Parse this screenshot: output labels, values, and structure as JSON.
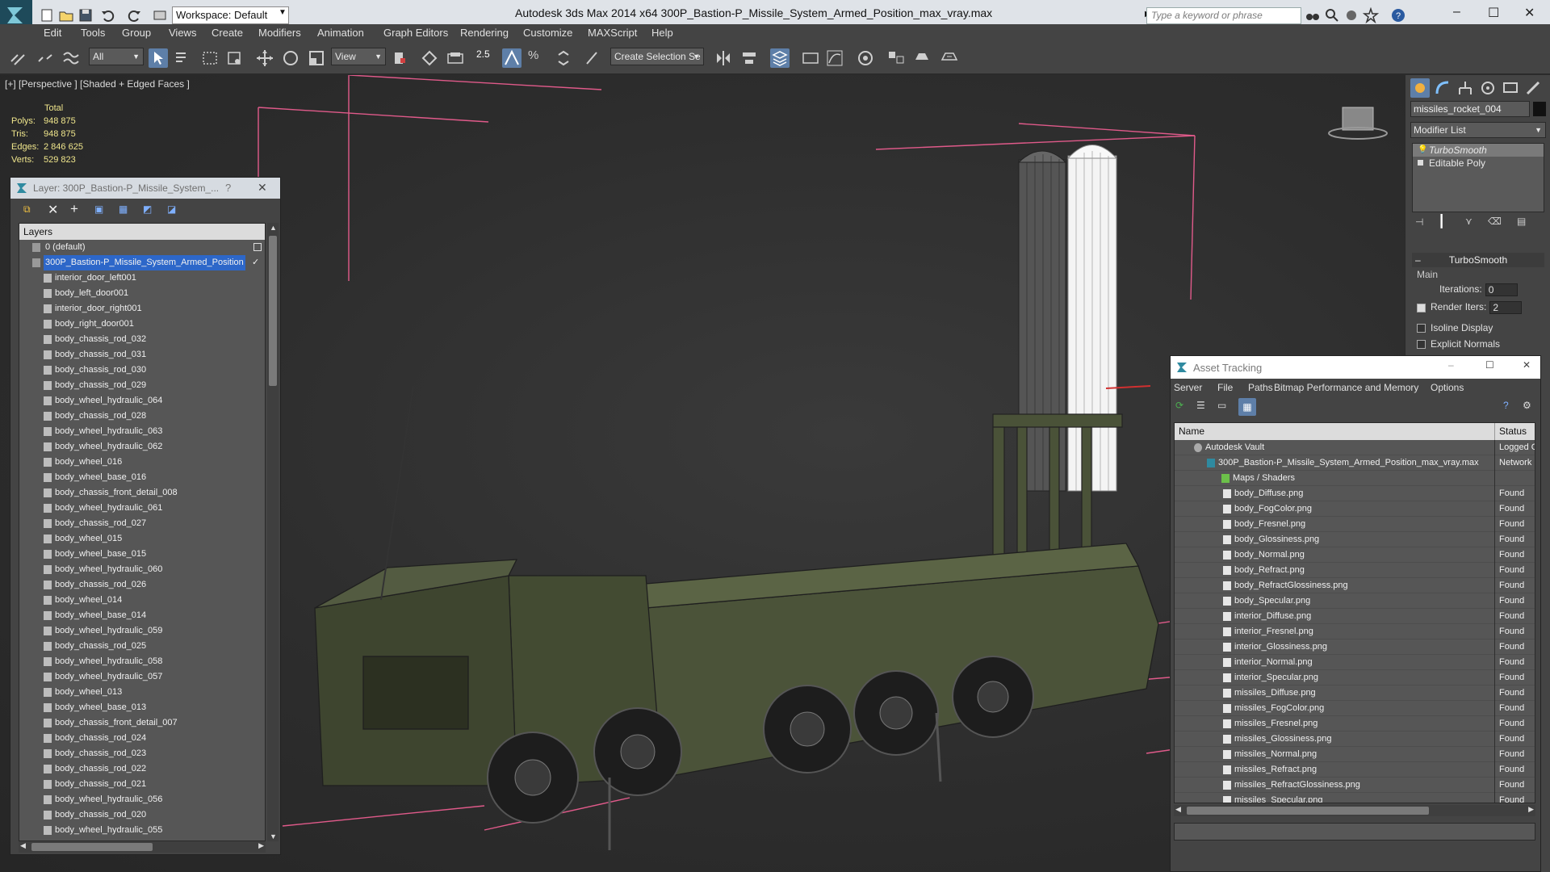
{
  "titlebar": {
    "workspace": "Workspace: Default",
    "title": "Autodesk 3ds Max  2014 x64      300P_Bastion-P_Missile_System_Armed_Position_max_vray.max",
    "search_placeholder": "Type a keyword or phrase",
    "minimize": "–",
    "maximize": "☐",
    "close": "✕"
  },
  "menu": [
    "Edit",
    "Tools",
    "Group",
    "Views",
    "Create",
    "Modifiers",
    "Animation",
    "Graph Editors",
    "Rendering",
    "Customize",
    "MAXScript",
    "Help"
  ],
  "toolbar": {
    "selection_filter": "All",
    "ref_coord": "View",
    "snap_label": "2.5",
    "named_selection": "Create Selection Se"
  },
  "viewport": {
    "label": "[+] [Perspective ] [Shaded + Edged Faces ]",
    "stats_header": "Total",
    "stats": [
      {
        "label": "Polys:",
        "value": "948 875"
      },
      {
        "label": "Tris:",
        "value": "948 875"
      },
      {
        "label": "Edges:",
        "value": "2 846 625"
      },
      {
        "label": "Verts:",
        "value": "529 823"
      }
    ]
  },
  "layer_panel": {
    "title": "Layer: 300P_Bastion-P_Missile_System_...",
    "help": "?",
    "close": "✕",
    "header": "Layers",
    "default_layer": "0 (default)",
    "selected_layer": "300P_Bastion-P_Missile_System_Armed_Position",
    "objects": [
      "interior_door_left001",
      "body_left_door001",
      "interior_door_right001",
      "body_right_door001",
      "body_chassis_rod_032",
      "body_chassis_rod_031",
      "body_chassis_rod_030",
      "body_chassis_rod_029",
      "body_wheel_hydraulic_064",
      "body_chassis_rod_028",
      "body_wheel_hydraulic_063",
      "body_wheel_hydraulic_062",
      "body_wheel_016",
      "body_wheel_base_016",
      "body_chassis_front_detail_008",
      "body_wheel_hydraulic_061",
      "body_chassis_rod_027",
      "body_wheel_015",
      "body_wheel_base_015",
      "body_wheel_hydraulic_060",
      "body_chassis_rod_026",
      "body_wheel_014",
      "body_wheel_base_014",
      "body_wheel_hydraulic_059",
      "body_chassis_rod_025",
      "body_wheel_hydraulic_058",
      "body_wheel_hydraulic_057",
      "body_wheel_013",
      "body_wheel_base_013",
      "body_chassis_front_detail_007",
      "body_chassis_rod_024",
      "body_chassis_rod_023",
      "body_chassis_rod_022",
      "body_chassis_rod_021",
      "body_wheel_hydraulic_056",
      "body_chassis_rod_020",
      "body_wheel_hydraulic_055"
    ]
  },
  "cmdpanel": {
    "object_name": "missiles_rocket_004",
    "modifier_list": "Modifier List",
    "stack": [
      "TurboSmooth",
      "Editable Poly"
    ],
    "rollout_title": "TurboSmooth",
    "group_main": "Main",
    "iterations_label": "Iterations:",
    "iterations_value": "0",
    "render_iters_label": "Render Iters:",
    "render_iters_value": "2",
    "isoline": "Isoline Display",
    "explicit_normals": "Explicit Normals"
  },
  "asset_panel": {
    "title": "Asset Tracking",
    "menu": [
      "Server",
      "File",
      "Paths",
      "Bitmap Performance and Memory",
      "Options"
    ],
    "col_name": "Name",
    "col_status": "Status",
    "vault": {
      "name": "Autodesk Vault",
      "status": "Logged Ou"
    },
    "file": {
      "name": "300P_Bastion-P_Missile_System_Armed_Position_max_vray.max",
      "status": "Network P"
    },
    "group": "Maps / Shaders",
    "maps": [
      {
        "name": "body_Diffuse.png",
        "status": "Found"
      },
      {
        "name": "body_FogColor.png",
        "status": "Found"
      },
      {
        "name": "body_Fresnel.png",
        "status": "Found"
      },
      {
        "name": "body_Glossiness.png",
        "status": "Found"
      },
      {
        "name": "body_Normal.png",
        "status": "Found"
      },
      {
        "name": "body_Refract.png",
        "status": "Found"
      },
      {
        "name": "body_RefractGlossiness.png",
        "status": "Found"
      },
      {
        "name": "body_Specular.png",
        "status": "Found"
      },
      {
        "name": "interior_Diffuse.png",
        "status": "Found"
      },
      {
        "name": "interior_Fresnel.png",
        "status": "Found"
      },
      {
        "name": "interior_Glossiness.png",
        "status": "Found"
      },
      {
        "name": "interior_Normal.png",
        "status": "Found"
      },
      {
        "name": "interior_Specular.png",
        "status": "Found"
      },
      {
        "name": "missiles_Diffuse.png",
        "status": "Found"
      },
      {
        "name": "missiles_FogColor.png",
        "status": "Found"
      },
      {
        "name": "missiles_Fresnel.png",
        "status": "Found"
      },
      {
        "name": "missiles_Glossiness.png",
        "status": "Found"
      },
      {
        "name": "missiles_Normal.png",
        "status": "Found"
      },
      {
        "name": "missiles_Refract.png",
        "status": "Found"
      },
      {
        "name": "missiles_RefractGlossiness.png",
        "status": "Found"
      },
      {
        "name": "missiles_Specular.png",
        "status": "Found"
      }
    ]
  },
  "colors": {
    "selection_blue": "#2d67c9",
    "stats_yellow": "#f0e68c",
    "vehicle_green": "#4a5238",
    "gizmo_pink": "#e05a8a"
  }
}
